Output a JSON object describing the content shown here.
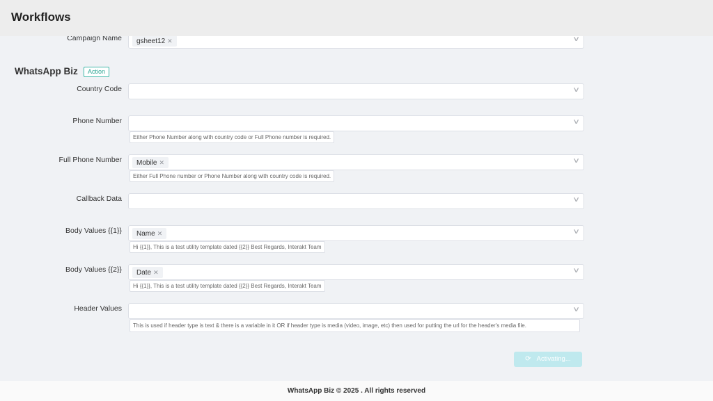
{
  "header": {
    "title": "Workflows"
  },
  "campaign": {
    "label": "Campaign Name",
    "tag": "gsheet12"
  },
  "section": {
    "title": "WhatsApp Biz",
    "badge": "Action"
  },
  "fields": {
    "country_code": {
      "label": "Country Code"
    },
    "phone_number": {
      "label": "Phone Number",
      "hint": "Either Phone Number along with country code or Full Phone number is required."
    },
    "full_phone_number": {
      "label": "Full Phone Number",
      "tag": "Mobile",
      "hint": "Either Full Phone number or Phone Number along with country code is required."
    },
    "callback_data": {
      "label": "Callback Data"
    },
    "body_values_1": {
      "label": "Body Values {{1}}",
      "tag": "Name",
      "hint": "Hi {{1}}, This is a test utility template dated {{2}} Best Regards, Interakt Team"
    },
    "body_values_2": {
      "label": "Body Values {{2}}",
      "tag": "Date",
      "hint": "Hi {{1}}, This is a test utility template dated {{2}} Best Regards, Interakt Team"
    },
    "header_values": {
      "label": "Header Values",
      "hint": "This is used if header type is text & there is a variable in it OR if header type is media (video, image, etc) then used for putting the url for the header's media file."
    }
  },
  "actions": {
    "activate_label": "Activating..."
  },
  "footer": {
    "text": "WhatsApp Biz © 2025 . All rights reserved"
  },
  "icons": {
    "chevron": "chevron-down-icon",
    "remove": "close-icon",
    "spinner": "loading-spinner-icon"
  }
}
